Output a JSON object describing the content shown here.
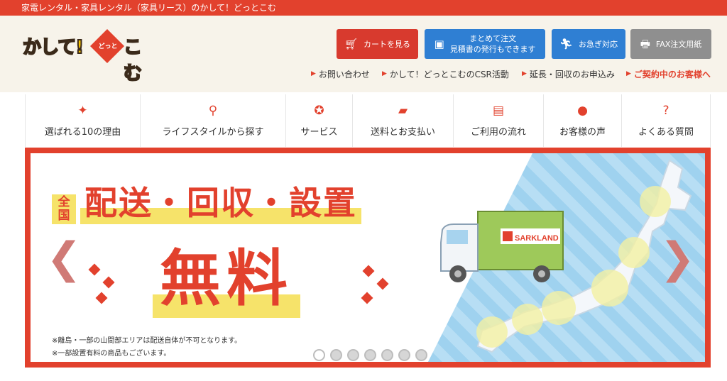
{
  "topbar": {
    "text": "家電レンタル・家具レンタル（家具リース）のかして！どっとこむ"
  },
  "logo": {
    "part1": "かして!",
    "middle": "どっと",
    "part2": "こむ"
  },
  "header_buttons": {
    "cart": "カートを見る",
    "estimate_line1": "まとめて注文",
    "estimate_line2": "見積書の発行もできます",
    "urgent": "お急ぎ対応",
    "fax": "FAX注文用紙"
  },
  "header_links": [
    "お問い合わせ",
    "かして！どっとこむのCSR活動",
    "延長・回収のお申込み",
    "ご契約中のお客様へ"
  ],
  "nav": [
    {
      "label": "選ばれる10の理由",
      "icon": "sparkle-icon",
      "glyph": "✦"
    },
    {
      "label": "ライフスタイルから探す",
      "icon": "search-icon",
      "glyph": "⚲"
    },
    {
      "label": "サービス",
      "icon": "ribbon-icon",
      "glyph": "✪"
    },
    {
      "label": "送料とお支払い",
      "icon": "truck-icon",
      "glyph": "▰"
    },
    {
      "label": "ご利用の流れ",
      "icon": "clipboard-icon",
      "glyph": "▤"
    },
    {
      "label": "お客様の声",
      "icon": "chat-icon",
      "glyph": "●"
    },
    {
      "label": "よくある質問",
      "icon": "question-icon",
      "glyph": "?"
    }
  ],
  "banner": {
    "zenkoku": "全国",
    "headline": "配送・回収・設置",
    "muryo": "無料",
    "note1": "※離島・一部の山間部エリアは配送自体が不可となります。",
    "note2": "※一部設置有料の商品もございます。",
    "truck_brand": "SARKLAND",
    "slide_count": 7,
    "active_slide": 1
  },
  "colors": {
    "brand_red": "#e2412d",
    "blue": "#2f7fd3",
    "gray": "#8f8f8f",
    "yellow": "#f6e36a"
  }
}
